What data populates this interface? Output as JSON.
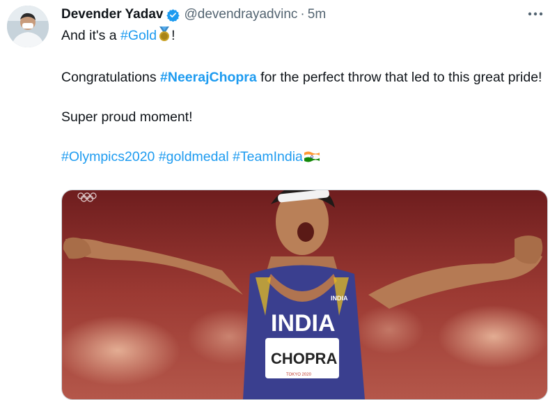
{
  "tweet": {
    "author_name": "Devender Yadav",
    "handle": "@devendrayadvinc",
    "separator": "·",
    "time": "5m",
    "line1_prefix": "And it's a ",
    "line1_tag": "#Gold",
    "line1_suffix": "!",
    "line2_prefix": "Congratulations ",
    "line2_tag": "#NeerajChopra",
    "line2_suffix": " for the perfect throw that led to this great pride!",
    "line3": "Super proud moment!",
    "hashtags": [
      "#Olympics2020",
      "#goldmedal",
      "#TeamIndia"
    ]
  },
  "media": {
    "jersey_text": "INDIA",
    "bib_name": "CHOPRA",
    "small_india_text": "INDIA",
    "bib_footer": "TOKYO 2020"
  },
  "icons": {
    "verified": "verified-badge-icon",
    "more": "more-options-icon",
    "medal": "gold-medal-emoji",
    "flag": "india-flag-emoji"
  },
  "colors": {
    "link": "#1d9bf0",
    "text": "#0f1419",
    "muted": "#536471",
    "verified": "#1d9bf0"
  }
}
